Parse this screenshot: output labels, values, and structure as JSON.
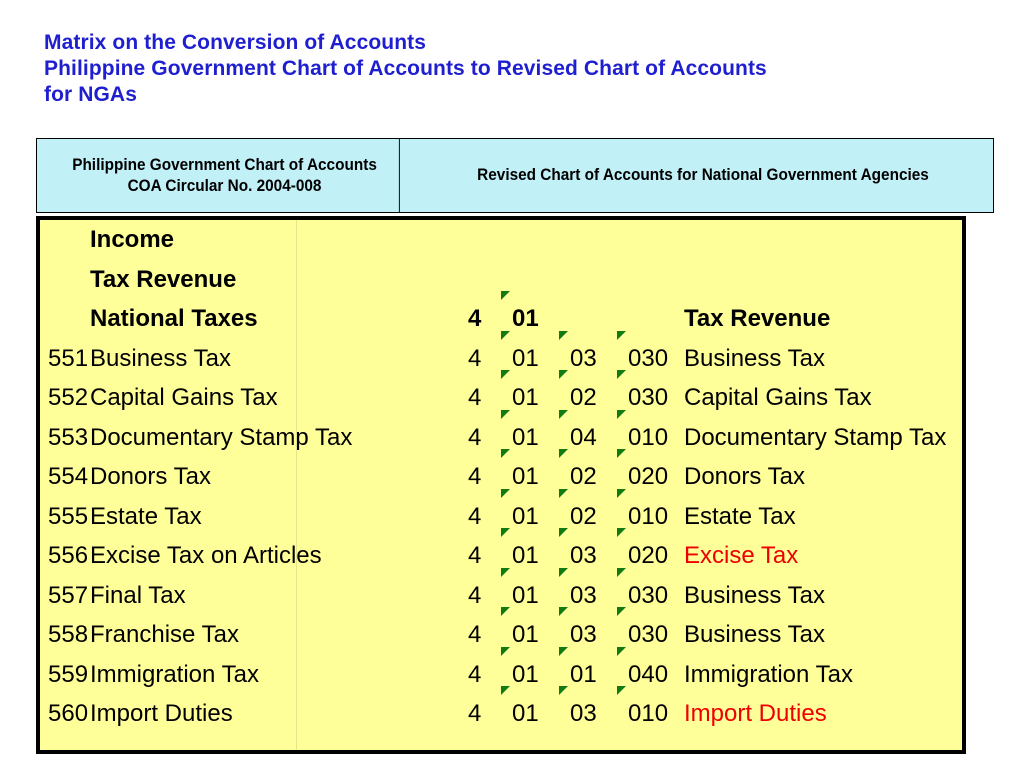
{
  "title": {
    "line1": "Matrix on the Conversion of Accounts",
    "line2": "Philippine Government Chart of Accounts to Revised Chart of Accounts",
    "line3": "for NGAs",
    "color": "#1f1fd0"
  },
  "table": {
    "header": {
      "left_line1": "Philippine Government Chart of Accounts",
      "left_line2": "COA Circular No. 2004-008",
      "right": "Revised Chart of Accounts for National Government Agencies",
      "background": "#c2f0f7"
    },
    "body": {
      "background": "#ffff99",
      "separator_color": "#127a12",
      "highlight_color": "#ee0000"
    },
    "rows": [
      {
        "left_code": "",
        "left_name": "Income",
        "codes": [],
        "right_name": "",
        "bold": true,
        "red": false
      },
      {
        "left_code": "",
        "left_name": "Tax Revenue",
        "codes": [],
        "right_name": "",
        "bold": true,
        "red": false
      },
      {
        "left_code": "",
        "left_name": "National Taxes",
        "codes": [
          "4",
          "01"
        ],
        "right_name": "Tax Revenue",
        "bold": true,
        "red": false
      },
      {
        "left_code": "551",
        "left_name": "Business Tax",
        "codes": [
          "4",
          "01",
          "03",
          "030"
        ],
        "right_name": "Business Tax",
        "bold": false,
        "red": false
      },
      {
        "left_code": "552",
        "left_name": "Capital Gains Tax",
        "codes": [
          "4",
          "01",
          "02",
          "030"
        ],
        "right_name": "Capital Gains Tax",
        "bold": false,
        "red": false
      },
      {
        "left_code": "553",
        "left_name": "Documentary Stamp Tax",
        "codes": [
          "4",
          "01",
          "04",
          "010"
        ],
        "right_name": "Documentary Stamp Tax",
        "bold": false,
        "red": false
      },
      {
        "left_code": "554",
        "left_name": "Donors Tax",
        "codes": [
          "4",
          "01",
          "02",
          "020"
        ],
        "right_name": "Donors Tax",
        "bold": false,
        "red": false
      },
      {
        "left_code": "555",
        "left_name": "Estate Tax",
        "codes": [
          "4",
          "01",
          "02",
          "010"
        ],
        "right_name": "Estate Tax",
        "bold": false,
        "red": false
      },
      {
        "left_code": "556",
        "left_name": "Excise Tax on Articles",
        "codes": [
          "4",
          "01",
          "03",
          "020"
        ],
        "right_name": "Excise Tax",
        "bold": false,
        "red": true
      },
      {
        "left_code": "557",
        "left_name": "Final Tax",
        "codes": [
          "4",
          "01",
          "03",
          "030"
        ],
        "right_name": "Business Tax",
        "bold": false,
        "red": false
      },
      {
        "left_code": "558",
        "left_name": "Franchise Tax",
        "codes": [
          "4",
          "01",
          "03",
          "030"
        ],
        "right_name": "Business Tax",
        "bold": false,
        "red": false
      },
      {
        "left_code": "559",
        "left_name": "Immigration Tax",
        "codes": [
          "4",
          "01",
          "01",
          "040"
        ],
        "right_name": "Immigration Tax",
        "bold": false,
        "red": false
      },
      {
        "left_code": "560",
        "left_name": "Import Duties",
        "codes": [
          "4",
          "01",
          "03",
          "010"
        ],
        "right_name": "Import Duties",
        "bold": false,
        "red": true
      }
    ]
  }
}
